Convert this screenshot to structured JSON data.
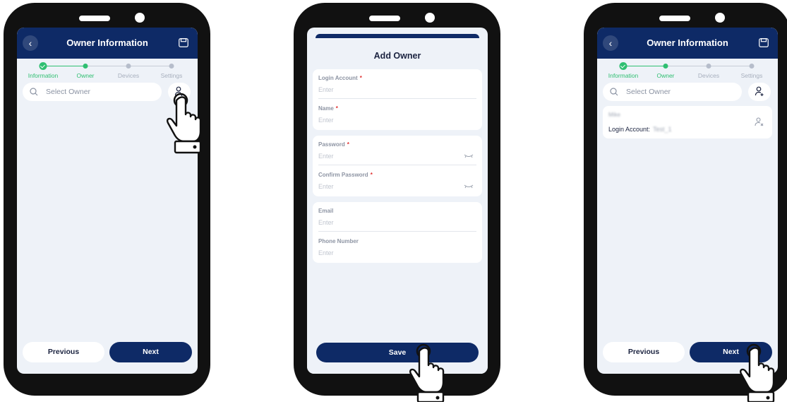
{
  "steps": {
    "information": "Information",
    "owner": "Owner",
    "devices": "Devices",
    "settings": "Settings"
  },
  "screen1": {
    "title": "Owner Information",
    "search_placeholder": "Select Owner",
    "previous_label": "Previous",
    "next_label": "Next"
  },
  "screen2": {
    "title": "Add Owner",
    "fields": [
      {
        "label": "Login Account",
        "required": "*",
        "placeholder": "Enter"
      },
      {
        "label": "Name",
        "required": "*",
        "placeholder": "Enter"
      },
      {
        "label": "Password",
        "required": "*",
        "placeholder": "Enter"
      },
      {
        "label": "Confirm Password",
        "required": "*",
        "placeholder": "Enter"
      },
      {
        "label": "Email",
        "placeholder": "Enter"
      },
      {
        "label": "Phone Number",
        "placeholder": "Enter"
      }
    ],
    "save_label": "Save"
  },
  "screen3": {
    "title": "Owner Information",
    "search_placeholder": "Select Owner",
    "owner_name": "Mike",
    "login_account_label": "Login Account:",
    "login_account_value": "Test_1",
    "previous_label": "Previous",
    "next_label": "Next"
  },
  "colors": {
    "navy": "#0e2a66",
    "green": "#2fbf71",
    "background": "#eef2f8",
    "required": "#e03232"
  },
  "icons": [
    "back-arrow-icon",
    "save-icon",
    "search-icon",
    "add-person-icon",
    "eye-closed-icon",
    "remove-person-icon",
    "pointing-hand-icon",
    "checkmark-icon"
  ]
}
